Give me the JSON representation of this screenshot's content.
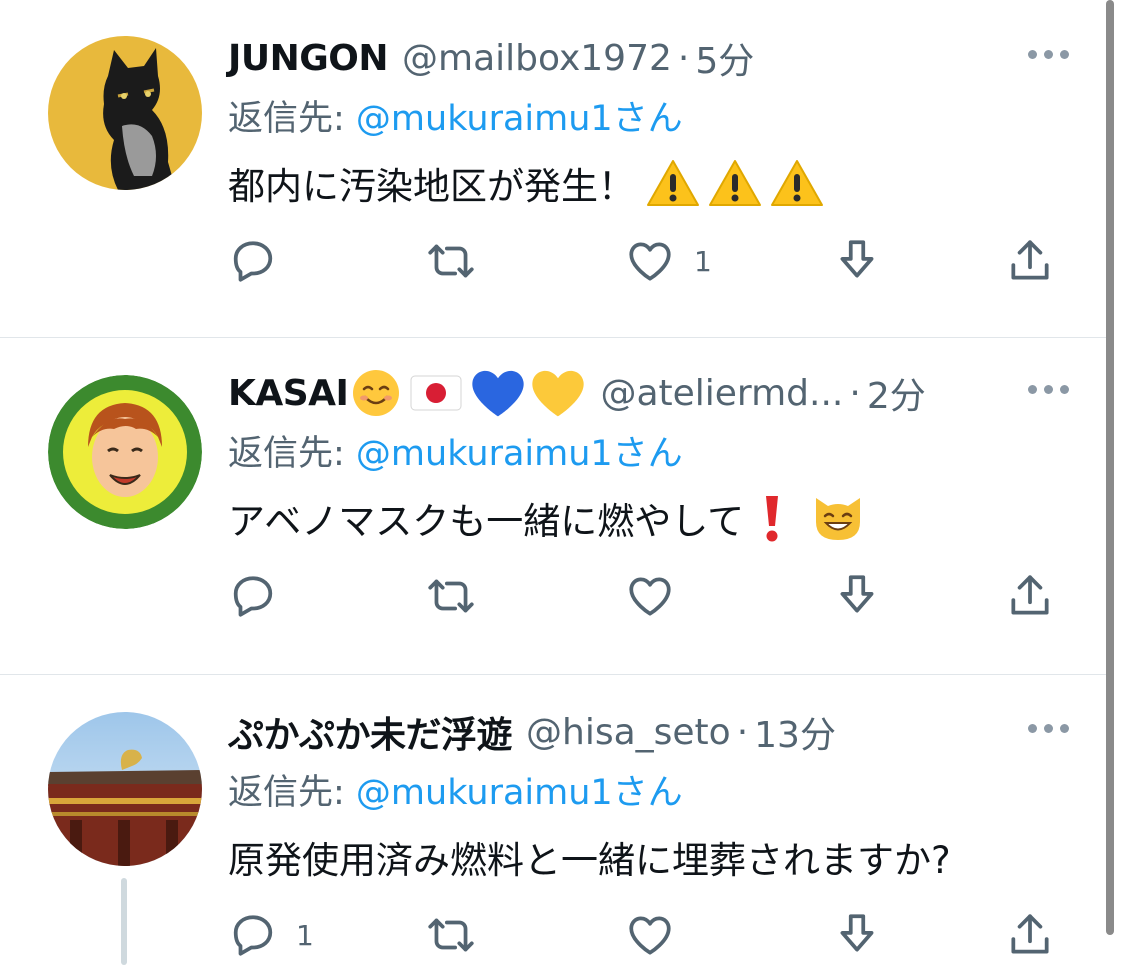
{
  "tweets": [
    {
      "name": "JUNGON",
      "name_emojis": [],
      "handle": "@mailbox1972",
      "time": "5分",
      "reply_label": "返信先: ",
      "reply_to": "@mukuraimu1さん",
      "text": "都内に汚染地区が発生！",
      "text_emojis": [
        "warning",
        "warning",
        "warning"
      ],
      "reply_count": "",
      "retweet_count": "",
      "like_count": "1"
    },
    {
      "name": "KASAI",
      "name_emojis": [
        "smiling-face",
        "japan-flag",
        "blue-heart",
        "yellow-heart"
      ],
      "handle": "@ateliermd...",
      "time": "2分",
      "reply_label": "返信先: ",
      "reply_to": "@mukuraimu1さん",
      "text": "アベノマスクも一緒に燃やして",
      "text_emojis": [
        "exclamation",
        "grinning-cat"
      ],
      "reply_count": "",
      "retweet_count": "",
      "like_count": ""
    },
    {
      "name": "ぷかぷか未だ浮遊",
      "name_emojis": [],
      "handle": "@hisa_seto",
      "time": "13分",
      "reply_label": "返信先: ",
      "reply_to": "@mukuraimu1さん",
      "text": "原発使用済み燃料と一緒に埋葬されますか?",
      "text_emojis": [],
      "reply_count": "1",
      "retweet_count": "",
      "like_count": ""
    }
  ],
  "separator": "·",
  "colors": {
    "link": "#1d9bf0",
    "secondary_text": "#536471",
    "icon": "#536471",
    "divider": "#e1e6ea"
  },
  "icons": [
    "reply-icon",
    "retweet-icon",
    "like-icon",
    "save-icon",
    "share-icon",
    "more-icon"
  ]
}
